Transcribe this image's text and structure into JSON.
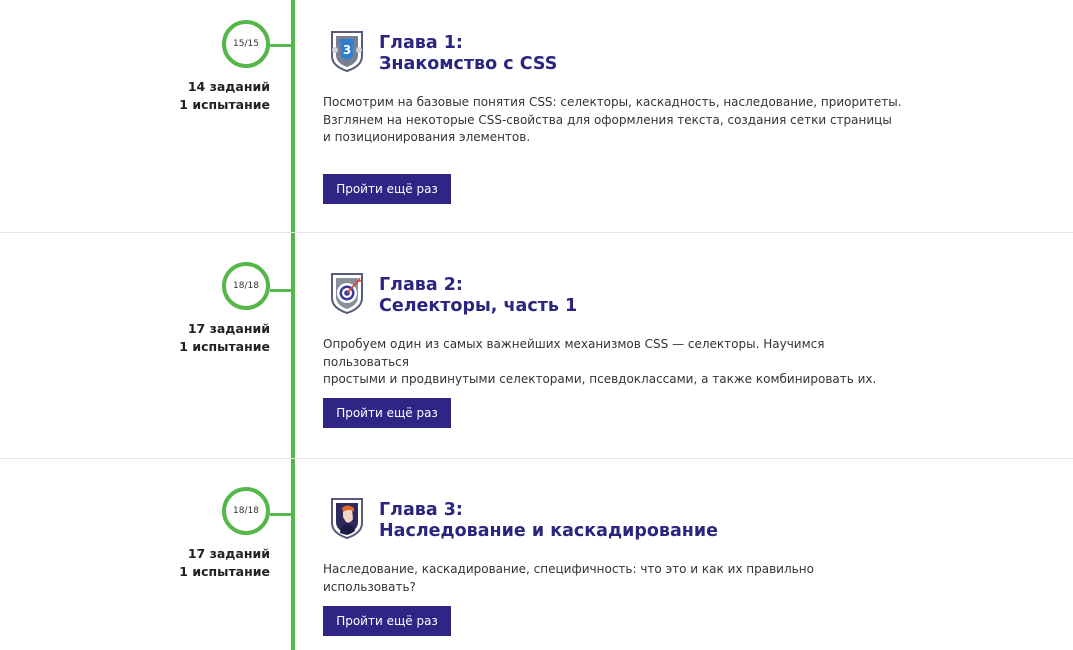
{
  "chapters": [
    {
      "progress": "15/15",
      "tasks": "14 заданий",
      "trials": "1 испытание",
      "title_line1": "Глава 1:",
      "title_line2": "Знакомство с CSS",
      "desc_lines": [
        "Посмотрим на базовые понятия CSS: селекторы, каскадность, наследование, приоритеты.",
        "Взглянем на некоторые CSS-свойства для оформления текста, создания сетки страницы",
        "и позиционирования элементов."
      ],
      "button": "Пройти ещё раз",
      "icon": "css3-shield-icon"
    },
    {
      "progress": "18/18",
      "tasks": "17 заданий",
      "trials": "1 испытание",
      "title_line1": "Глава 2:",
      "title_line2": "Селекторы, часть 1",
      "desc_lines": [
        "Опробуем один из самых важнейших механизмов CSS — селекторы. Научимся пользоваться",
        "простыми и продвинутыми селекторами, псевдоклассами, а также комбинировать их."
      ],
      "button": "Пройти ещё раз",
      "icon": "target-shield-icon"
    },
    {
      "progress": "18/18",
      "tasks": "17 заданий",
      "trials": "1 испытание",
      "title_line1": "Глава 3:",
      "title_line2": "Наследование и каскадирование",
      "desc_lines": [
        "Наследование, каскадирование, специфичность: что это и как их правильно использовать?"
      ],
      "button": "Пройти ещё раз",
      "icon": "portrait-shield-icon"
    }
  ],
  "colors": {
    "accent_green": "#55b74a",
    "title_purple": "#2b2580",
    "button_purple": "#2f2585"
  }
}
